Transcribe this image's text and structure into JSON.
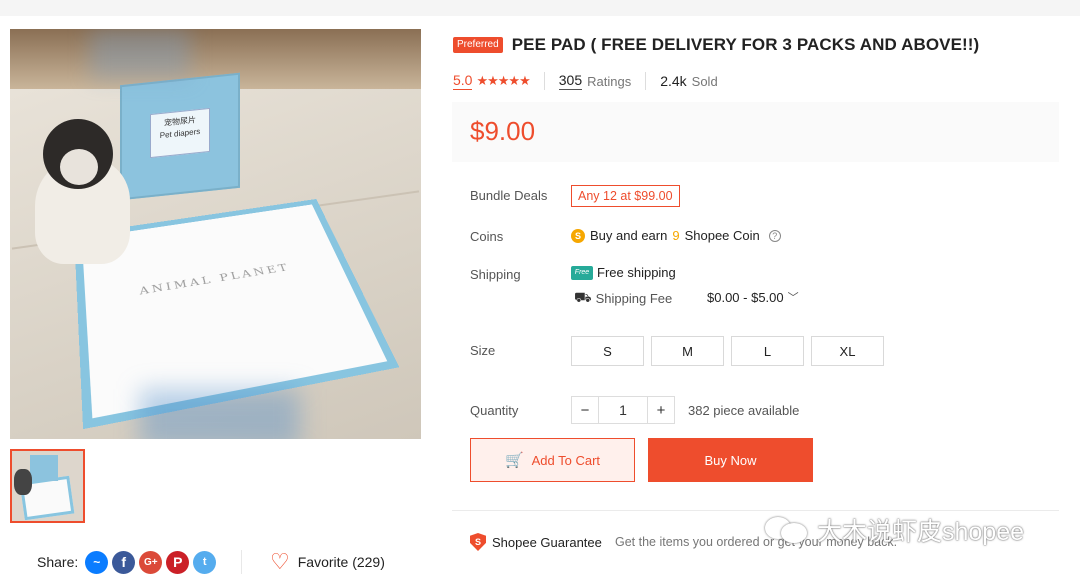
{
  "product": {
    "badge": "Preferred",
    "title": "PEE PAD ( FREE DELIVERY FOR 3 PACKS AND ABOVE!!)",
    "image_logo_text": "ANIMAL PLANET",
    "box_label_cn": "宠物尿片",
    "box_label_en": "Pet diapers"
  },
  "stats": {
    "rating_value": "5.0",
    "stars": "★★★★★",
    "ratings_count": "305",
    "ratings_label": "Ratings",
    "sold_count": "2.4k",
    "sold_label": "Sold"
  },
  "price": "$9.00",
  "bundle": {
    "label": "Bundle Deals",
    "tag": "Any 12 at $99.00"
  },
  "coins": {
    "label": "Coins",
    "prefix": "Buy and earn",
    "amount": "9",
    "suffix": "Shopee Coin",
    "help": "?"
  },
  "shipping": {
    "label": "Shipping",
    "free_badge": "Free",
    "free_text": "Free shipping",
    "fee_label": "Shipping Fee",
    "fee_range": "$0.00 - $5.00"
  },
  "size": {
    "label": "Size",
    "options": [
      "S",
      "M",
      "L",
      "XL"
    ]
  },
  "quantity": {
    "label": "Quantity",
    "minus": "−",
    "value": "1",
    "plus": "+",
    "available": "382 piece available"
  },
  "actions": {
    "add_to_cart": "Add To Cart",
    "buy_now": "Buy Now"
  },
  "guarantee": {
    "title": "Shopee Guarantee",
    "text": "Get the items you ordered or get your money back."
  },
  "share": {
    "label": "Share:",
    "icons": [
      "messenger-icon",
      "facebook-icon",
      "google-plus-icon",
      "pinterest-icon",
      "twitter-icon"
    ],
    "glyphs": {
      "messenger": "~",
      "facebook": "f",
      "google_plus": "G+",
      "pinterest": "P",
      "twitter": "t"
    }
  },
  "favorite": {
    "label": "Favorite (229)",
    "heart": "♡"
  },
  "watermark": "大木说虾皮shopee",
  "colors": {
    "accent": "#ee4d2d",
    "free_shipping": "#26aa99",
    "coin": "#f6a700"
  }
}
